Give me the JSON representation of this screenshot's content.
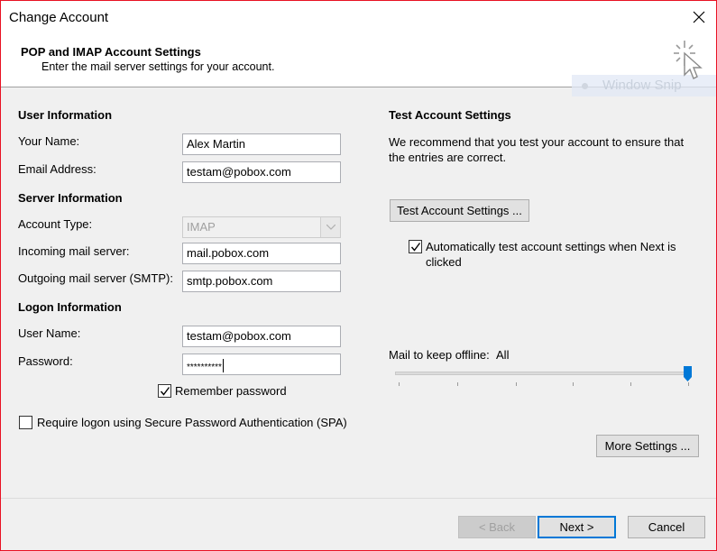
{
  "window": {
    "title": "Change Account"
  },
  "header": {
    "title": "POP and IMAP Account Settings",
    "subtitle": "Enter the mail server settings for your account.",
    "overlay_text": "Window Snip"
  },
  "user_info": {
    "heading": "User Information",
    "name_label": "Your Name:",
    "name_value": "Alex Martin",
    "email_label": "Email Address:",
    "email_value": "testam@pobox.com"
  },
  "server_info": {
    "heading": "Server Information",
    "account_type_label": "Account Type:",
    "account_type_value": "IMAP",
    "incoming_label": "Incoming mail server:",
    "incoming_value": "mail.pobox.com",
    "outgoing_label": "Outgoing mail server (SMTP):",
    "outgoing_value": "smtp.pobox.com"
  },
  "logon_info": {
    "heading": "Logon Information",
    "username_label": "User Name:",
    "username_value": "testam@pobox.com",
    "password_label": "Password:",
    "password_value": "**********",
    "remember_label": "Remember password",
    "remember_checked": true,
    "spa_label": "Require logon using Secure Password Authentication (SPA)",
    "spa_checked": false
  },
  "test_settings": {
    "heading": "Test Account Settings",
    "description": "We recommend that you test your account to ensure that the entries are correct.",
    "button_label": "Test Account Settings ...",
    "auto_test_label": "Automatically test account settings when Next is clicked",
    "auto_test_checked": true
  },
  "offline": {
    "label": "Mail to keep offline:",
    "value": "All",
    "slider_level": 1.0
  },
  "buttons": {
    "more_settings": "More Settings ...",
    "back": "< Back",
    "next": "Next >",
    "cancel": "Cancel"
  },
  "colors": {
    "accent": "#0078d7",
    "close_border": "#e81123"
  }
}
